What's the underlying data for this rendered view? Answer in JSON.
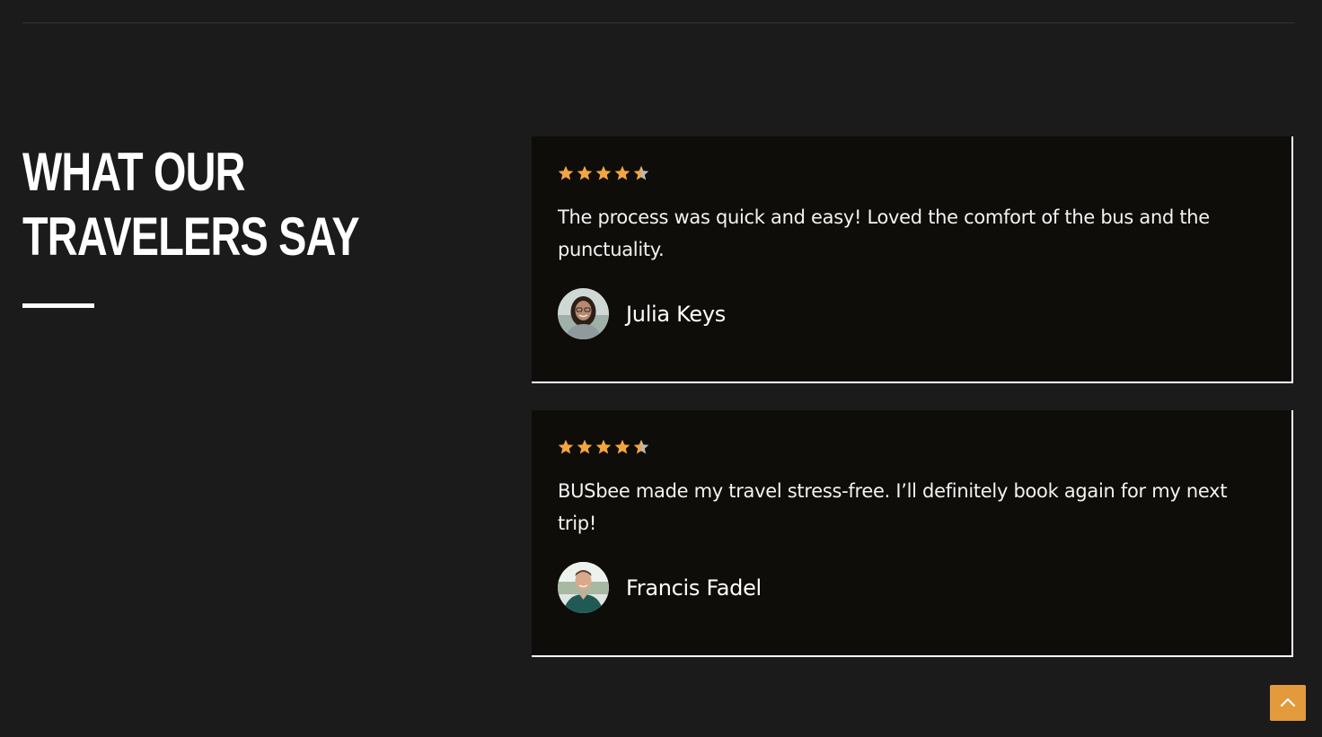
{
  "section": {
    "heading_line1": "WHAT OUR",
    "heading_line2": "TRAVELERS SAY"
  },
  "colors": {
    "background": "#1b1b1b",
    "card": "#0e0d09",
    "star": "#f2a541",
    "star_partial": "#b9b9b9",
    "accent": "#e39a3d"
  },
  "testimonials": [
    {
      "rating": 4.5,
      "quote": "The process was quick and easy! Loved the comfort of the bus and the punctuality.",
      "name": "Julia Keys",
      "avatar_icon": "avatar-woman-icon"
    },
    {
      "rating": 4.5,
      "quote": "BUSbee made my travel stress-free. I’ll definitely book again for my next trip!",
      "name": "Francis Fadel",
      "avatar_icon": "avatar-man-icon"
    }
  ],
  "scroll_top": {
    "icon": "chevron-up-icon"
  }
}
